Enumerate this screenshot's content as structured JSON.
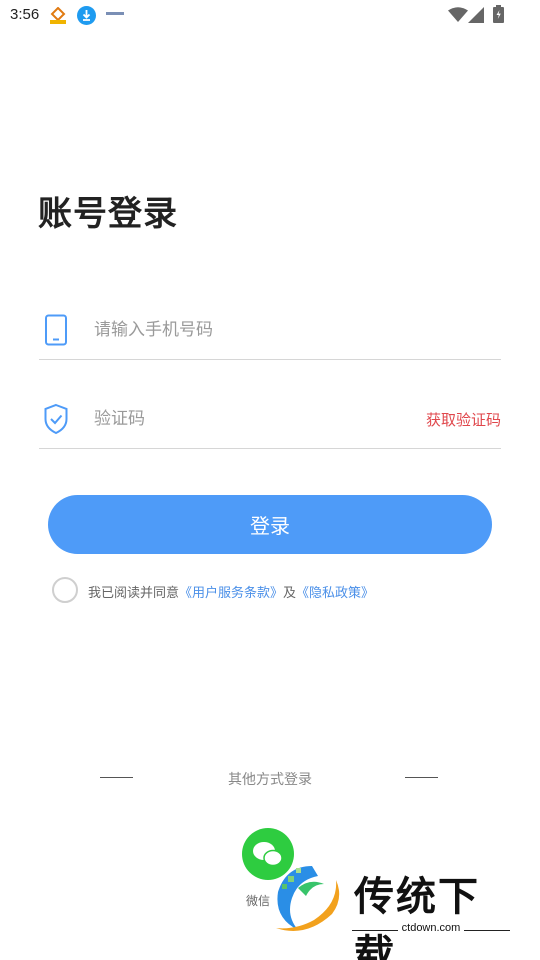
{
  "status_bar": {
    "time": "3:56"
  },
  "login": {
    "title": "账号登录",
    "phone_placeholder": "请输入手机号码",
    "code_placeholder": "验证码",
    "get_code_label": "获取验证码",
    "login_button": "登录"
  },
  "agreement": {
    "prefix": "我已阅读并同意",
    "terms_link": "《用户服务条款》",
    "joiner": "及",
    "privacy_link": "《隐私政策》",
    "checked": false
  },
  "other_login": {
    "label": "其他方式登录",
    "wechat_label": "微信"
  },
  "watermark": {
    "brand": "传统下载",
    "domain": "ctdown.com"
  },
  "colors": {
    "accent": "#4e9bf8",
    "link": "#4a8fe8",
    "get_code": "#e0474c",
    "wechat": "#2ecc40"
  },
  "icons": {
    "phone_field": "phone-icon",
    "code_field": "shield-check-icon",
    "wechat": "wechat-icon"
  }
}
